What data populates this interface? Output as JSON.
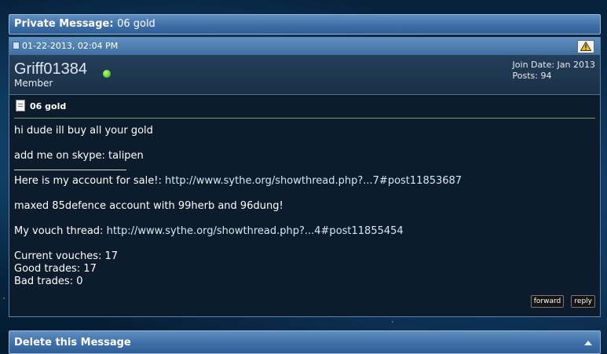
{
  "header": {
    "prefix": "Private Message:",
    "subject": "06 gold"
  },
  "post": {
    "date": "01-22-2013, 02:04 PM",
    "username": "Griff01384",
    "user_title": "Member",
    "join_date": "Join Date: Jan 2013",
    "posts": "Posts: 94",
    "title": "06 gold",
    "lines": {
      "l1": "hi dude ill buy all your gold",
      "l2": "add me on skype: talipen",
      "l3_label": "Here is my account for sale!:",
      "l3_link": "http://www.sythe.org/showthread.php?...7#post11853687",
      "l4": "maxed 85defence account with 99herb and 96dung!",
      "l5_label": "My vouch thread:",
      "l5_link": "http://www.sythe.org/showthread.php?...4#post11855454",
      "l6": "Current vouches: 17",
      "l7": "Good trades: 17",
      "l8": "Bad trades: 0"
    },
    "controls": {
      "forward": "forward",
      "reply": "reply"
    }
  },
  "delete_section": {
    "title": "Delete this Message"
  },
  "colors": {
    "header_blue": "#3f6fa6",
    "post_bg": "#0c1c2c",
    "online": "#2ea80a"
  }
}
